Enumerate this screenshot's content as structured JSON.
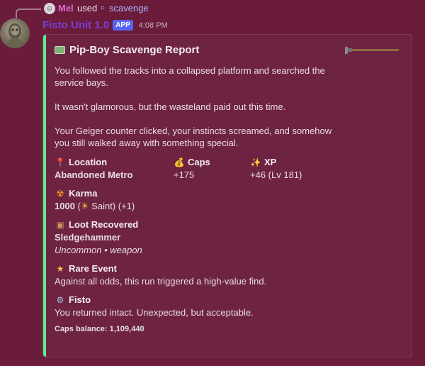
{
  "reply": {
    "user": "Mel",
    "used_text": "used",
    "command": "scavenge"
  },
  "message": {
    "bot_name": "Fisto Unit 1.0",
    "badge": "APP",
    "time": "4:08 PM"
  },
  "embed": {
    "accent_color": "#57f287",
    "title": "Pip-Boy Scavenge Report",
    "description": [
      "You followed the tracks into a collapsed platform and searched the service bays.",
      "It wasn't glamorous, but the wasteland paid out this time.",
      "Your Geiger counter clicked, your instincts screamed, and somehow you still walked away with something special."
    ],
    "fields": {
      "location": {
        "icon": "pin-icon",
        "name": "Location",
        "value": "Abandoned Metro"
      },
      "caps": {
        "icon": "money-bag-icon",
        "name": "Caps",
        "value": "+175"
      },
      "xp": {
        "icon": "sparkles-icon",
        "name": "XP",
        "value": "+46 (Lv 181)"
      },
      "karma": {
        "icon": "radioactive-icon",
        "name": "Karma",
        "value_number": "1000",
        "value_rest": "Saint) (+1)"
      },
      "loot": {
        "icon": "box-icon",
        "name": "Loot Recovered",
        "item": "Sledgehammer",
        "detail": "Uncommon • weapon"
      },
      "rare": {
        "icon": "star-icon",
        "name": "Rare Event",
        "value": "Against all odds, this run triggered a high-value find."
      },
      "fisto": {
        "icon": "robot-icon",
        "name": "Fisto",
        "value": "You returned intact. Unexpected, but acceptable."
      }
    },
    "footer": "Caps balance: 1,109,440"
  }
}
